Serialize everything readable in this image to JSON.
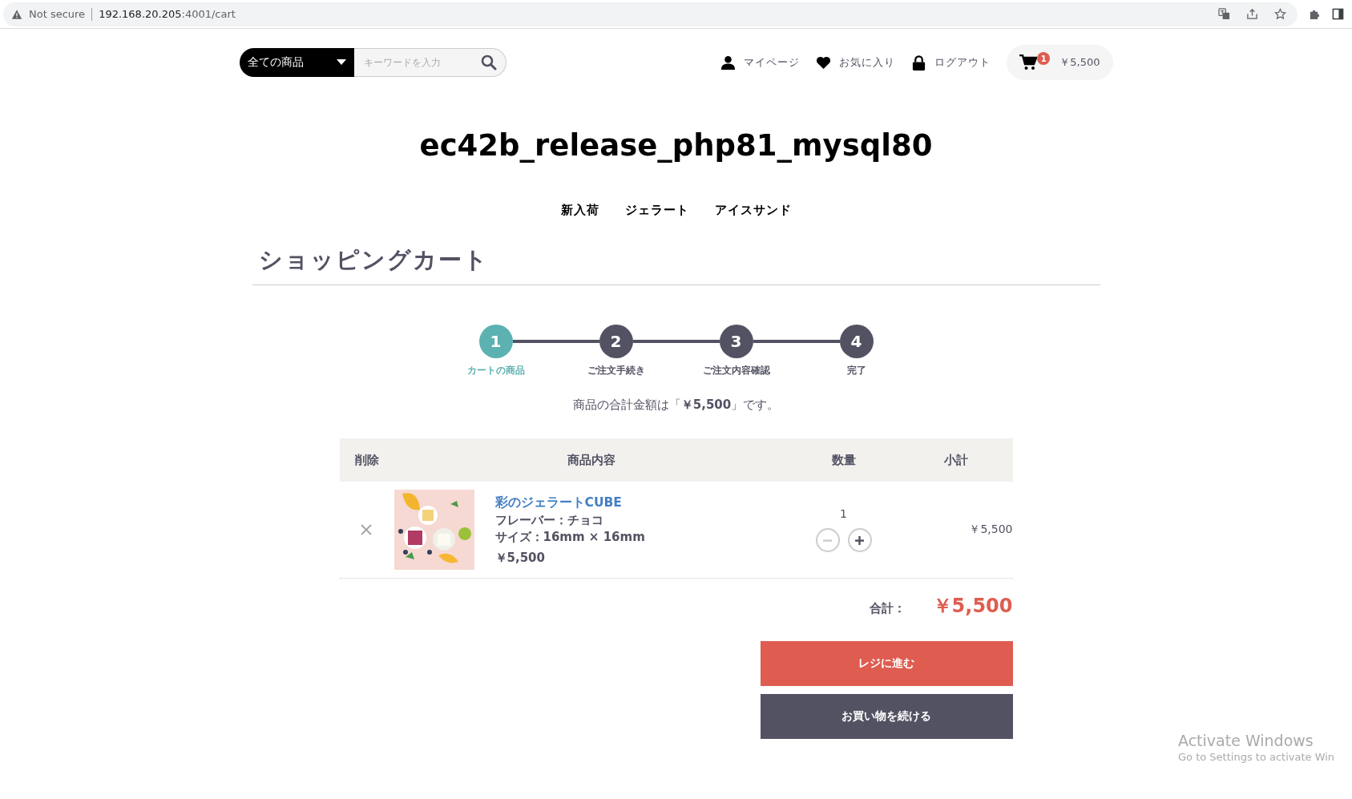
{
  "browser": {
    "security": "Not secure",
    "url_host": "192.168.20.205",
    "url_path": ":4001/cart"
  },
  "header": {
    "category": "全ての商品",
    "search_placeholder": "キーワードを入力",
    "links": [
      {
        "label": "マイページ",
        "kind": "user"
      },
      {
        "label": "お気に入り",
        "kind": "heart"
      },
      {
        "label": "ログアウト",
        "kind": "lock"
      }
    ],
    "cart": {
      "count": "1",
      "total": "￥5,500"
    }
  },
  "site_title": "ec42b_release_php81_mysql80",
  "nav": [
    "新入荷",
    "ジェラート",
    "アイスサンド"
  ],
  "page_title": "ショッピングカート",
  "steps": [
    {
      "number": "1",
      "label": "カートの商品",
      "selected": true
    },
    {
      "number": "2",
      "label": "ご注文手続き",
      "selected": false
    },
    {
      "number": "3",
      "label": "ご注文内容確認",
      "selected": false
    },
    {
      "number": "4",
      "label": "完了",
      "selected": false
    }
  ],
  "summary": "商品の合計金額は「**￥5,500**」です。",
  "table": {
    "columns": [
      "削除",
      "商品内容",
      "数量",
      "小計"
    ],
    "rows": [
      {
        "name": "彩のジェラートCUBE",
        "details": [
          "フレーバー：チョコ",
          "サイズ：16mm × 16mm"
        ],
        "price": "￥5,500",
        "quantity": "1",
        "subtotal": "￥5,500",
        "minus_disabled": true
      }
    ]
  },
  "total": {
    "label": "合計：",
    "value": "￥5,500"
  },
  "buttons": [
    {
      "label": "レジに進む",
      "kind": "primary"
    },
    {
      "label": "お買い物を続ける",
      "kind": "secondary"
    }
  ],
  "os_notice": {
    "title": "Activate Windows",
    "text": "Go to Settings to activate Win"
  }
}
